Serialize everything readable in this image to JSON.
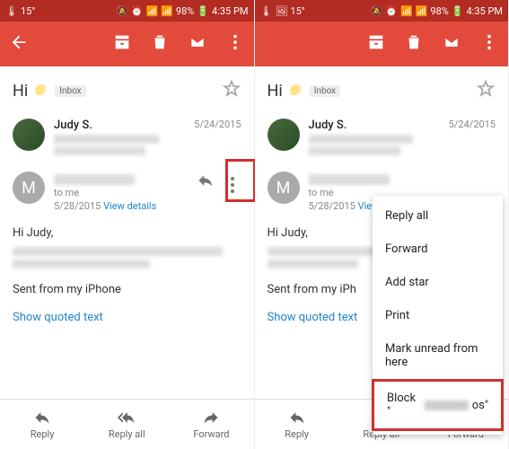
{
  "status": {
    "temp": "15°",
    "battery": "98%",
    "time": "4:35 PM"
  },
  "subject": "Hi",
  "inbox_chip": "Inbox",
  "msg1": {
    "sender": "Judy S.",
    "date": "5/24/2015"
  },
  "msg2": {
    "avatar_letter": "M",
    "tome": "to me",
    "date": "5/28/2015",
    "view": "View details"
  },
  "body": {
    "greeting": "Hi Judy,",
    "sig": "Sent from my iPhone"
  },
  "body_right": {
    "sig": "Sent from my iPh"
  },
  "show_quoted": "Show quoted text",
  "bottom": {
    "reply": "Reply",
    "reply_all": "Reply all",
    "forward": "Forward"
  },
  "popup": {
    "reply_all": "Reply all",
    "forward": "Forward",
    "add_star": "Add star",
    "print": "Print",
    "mark_unread": "Mark unread from here",
    "block_pre": "Block \"",
    "block_suf": "os\""
  }
}
